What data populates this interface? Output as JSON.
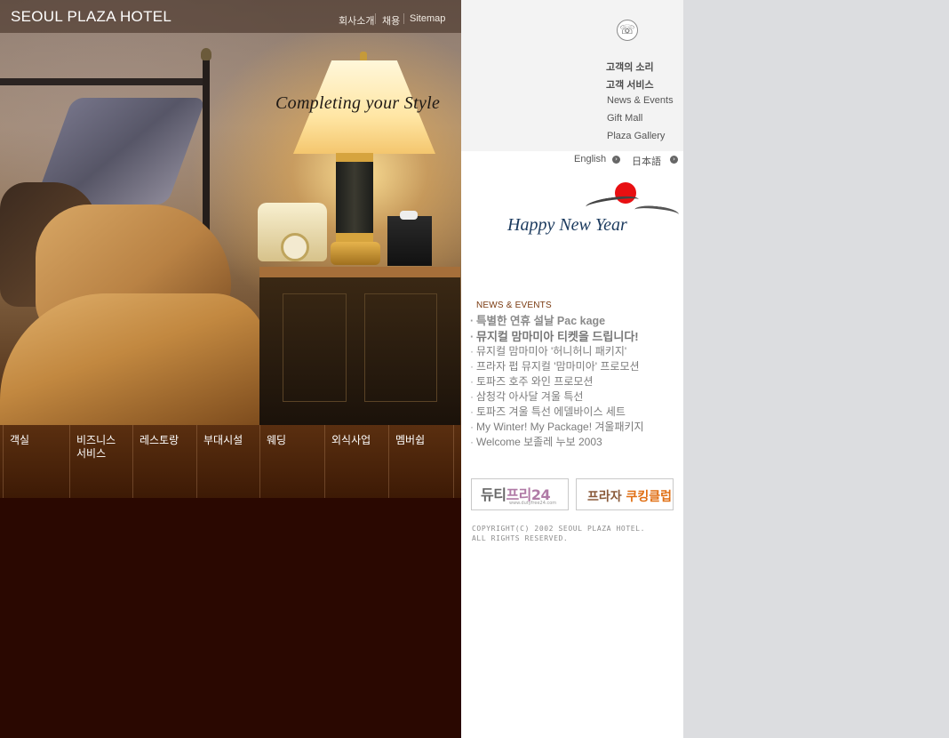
{
  "header": {
    "brand": "SEOUL PLAZA HOTEL",
    "links": [
      "회사소개",
      "채용",
      "Sitemap"
    ],
    "tagline": "Completing your Style"
  },
  "main_menu": [
    {
      "label": "객실"
    },
    {
      "label": "비즈니스\n서비스"
    },
    {
      "label": "레스토랑"
    },
    {
      "label": "부대시설"
    },
    {
      "label": "웨딩"
    },
    {
      "label": "외식사업"
    },
    {
      "label": "멤버쉽"
    }
  ],
  "quick_links": {
    "phone_icon": "phone-icon",
    "items": [
      "고객의 소리",
      "고객 서비스",
      "News & Events",
      "Gift Mall",
      "Plaza Gallery"
    ]
  },
  "languages": [
    "English",
    "日本語"
  ],
  "greeting": "Happy New Year",
  "news": {
    "heading": "NEWS & EVENTS",
    "items": [
      "특별한 연휴 설날 Pac kage",
      "뮤지컬 맘마미아 티켓을 드립니다!",
      "뮤지컬 맘마미아 '허니허니 패키지'",
      "프라자 펍 뮤지컬 '맘마미아' 프로모션",
      "토파즈 호주 와인 프로모션",
      "삼청각 아사달 겨울 특선",
      "토파즈 겨울 특선 에델바이스 세트",
      "My Winter! My Package! 겨울패키지",
      "Welcome 보졸레 누보 2003"
    ]
  },
  "banners": {
    "dutyfree": {
      "main": "듀티",
      "accent": "프리24",
      "sub": "www.dutyfree24.com"
    },
    "cooking": {
      "main": "프라자",
      "accent": "쿠킹클럽"
    }
  },
  "copyright": [
    "COPYRIGHT(C) 2002 SEOUL PLAZA HOTEL.",
    "ALL RIGHTS RESERVED."
  ],
  "colors": {
    "menu_bg": "#3d1a05",
    "lower_bg": "#2a0801",
    "sidebar_bg": "#f3f3f3",
    "page_bg": "#dcdde0",
    "sun_red": "#e80f12",
    "greeting_blue": "#1b3a5e"
  }
}
